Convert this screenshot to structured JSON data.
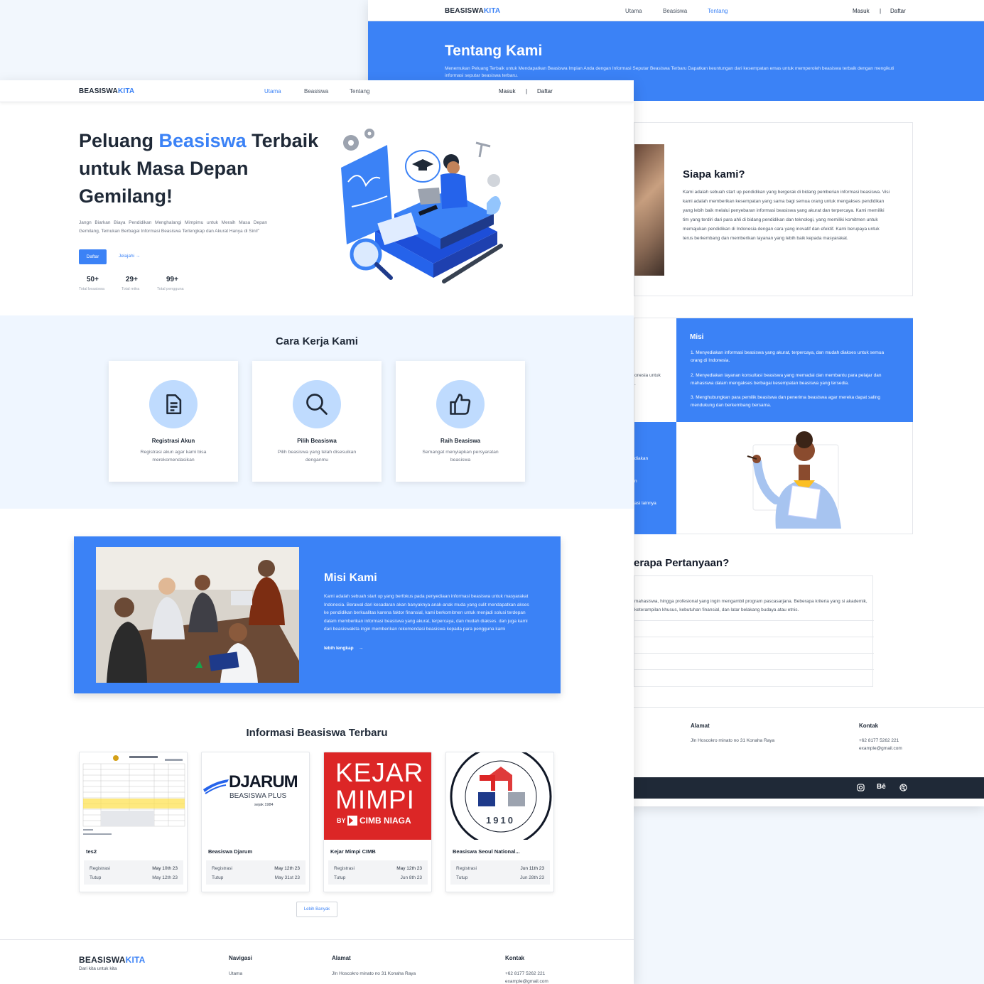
{
  "brand": {
    "name": "BEASISWA",
    "accent": "KITA",
    "tagline": "Dari kita untuk kita"
  },
  "nav": {
    "home": "Utama",
    "scholarship": "Beasiswa",
    "about": "Tentang",
    "login": "Masuk",
    "separator": "|",
    "register": "Daftar"
  },
  "about_page": {
    "hero_title": "Tentang Kami",
    "hero_desc": "Menemukan Peluang Terbaik untuk Mendapatkan Beasiswa Impian Anda dengan Informasi Seputar Beasiswa Terbaru Dapatkan keuntungan dari kesempatan emas untuk memperoleh beasiswa terbaik dengan mengikuti informasi seputar beasiswa terbaru.",
    "who_title": "Siapa kami?",
    "who_text": "Kami adalah sebuah start up pendidikan yang bergerak di bidang pemberian informasi beasiswa. Visi kami adalah memberikan kesempatan yang sama bagi semua orang untuk mengakses pendidikan yang lebih baik melalui penyebaran informasi beasiswa yang akurat dan terpercaya. Kami memiliki tim yang terdiri dari para ahli di bidang pendidikan dan teknologi, yang memiliki komitmen untuk memajukan pendidikan di Indonesia dengan cara yang inovatif dan efektif. Kami berupaya untuk terus berkembang dan memberikan layanan yang lebih baik kepada masyarakat.",
    "mission_title": "Misi",
    "missions": [
      "1. Menyediakan informasi beasiswa yang akurat, terpercaya, dan mudah diakses untuk semua orang di Indonesia.",
      "2. Menyediakan layanan konsultasi beasiswa yang memadai dan membantu para pelajar dan mahasiswa dalam mengakses berbagai kesempatan beasiswa yang tersedia.",
      "3. Menghubungkan para pemilik beasiswa dan penerima beasiswa agar mereka dapat saling mendukung dan berkembang bersama."
    ],
    "left_fragment_1": "onesia untuk",
    "left_fragment_2": ".",
    "left_fragment_3": "diakan",
    "left_fragment_4": "n",
    "left_fragment_5": "asi lainnya",
    "faq_title": "erapa Pertanyaan?",
    "faq_answer": "mahasiswa, hingga profesional yang ingin mengambil program pascasarjana. Beberapa kriteria yang si akademik, keterampilan khusus, kebutuhan finansial, dan latar belakang budaya atau etnis.",
    "footer_address_title": "Alamat",
    "footer_address": "Jln Hoscokro minato no 31 Konaha Raya",
    "footer_contact_title": "Kontak",
    "footer_phone": "+62 8177 5262 221",
    "footer_email": "example@gmail.com",
    "social": {
      "instagram": "instagram-icon",
      "behance": "Bē",
      "dribbble": "dribbble-icon"
    }
  },
  "home_page": {
    "hero_title_1": "Peluang ",
    "hero_title_accent": "Beasiswa",
    "hero_title_2": " Terbaik",
    "hero_title_3": "untuk Masa Depan",
    "hero_title_4": "Gemilang!",
    "hero_desc": "Jangn Biarkan Biaya Pendidikan Menghalangi Mimpimu untuk Meraih Masa Depan Gemilang, Temukan Berbagai Informasi Beasiswa Terlengkap dan Akurat Hanya di Sini!\"",
    "cta_register": "Daftar",
    "cta_explore": "Jelajahi",
    "stats": [
      {
        "value": "50+",
        "label": "Total beasiswa"
      },
      {
        "value": "29+",
        "label": "Total mitra"
      },
      {
        "value": "99+",
        "label": "Total pengguna"
      }
    ],
    "how_title": "Cara Kerja Kami",
    "steps": [
      {
        "title": "Registrasi Akun",
        "desc": "Registrasi akun agar kami bisa merekomendasikan",
        "icon": "document-icon"
      },
      {
        "title": "Pilih Beasiswa",
        "desc": "Pilih beasiswa yang telah disesuikan denganmu",
        "icon": "search-icon"
      },
      {
        "title": "Raih Beasiswa",
        "desc": "Semangat menyiapkan persyaratan beasiswa",
        "icon": "thumbs-up-icon"
      }
    ],
    "mission_title": "Misi Kami",
    "mission_text": "Kami adalah sebuah start up yang berfokus pada penyediaan informasi beasiswa untuk masyarakat Indonesia. Berawal dari kesadaran akan banyaknya anak-anak muda yang sulit mendapatkan akses ke pendidikan berkualitas karena faktor finansial, kami berkomitmen untuk menjadi solusi terdepan dalam memberikan informasi beasiswa yang akurat, terpercaya, dan mudah diakses. dan juga kami dari beasiswakita ingin memberikan rekomendasi beasiswa kepada para pengguna kami",
    "mission_link": "lebih lengkap",
    "latest_title": "Informasi Beasiswa Terbaru",
    "scholarships": [
      {
        "title": "tes2",
        "reg_label": "Registrasi",
        "reg": "May 10th 23",
        "close_label": "Tutup",
        "close": "May 12th 23"
      },
      {
        "title": "Beasiswa Djarum",
        "reg_label": "Registrasi",
        "reg": "May 12th 23",
        "close_label": "Tutup",
        "close": "May 31st 23"
      },
      {
        "title": "Kejar Mimpi CIMB",
        "reg_label": "Registrasi",
        "reg": "May 12th 23",
        "close_label": "Tutup",
        "close": "Jun 8th 23"
      },
      {
        "title": "Beasiswa Seoul National...",
        "reg_label": "Registrasi",
        "reg": "Jun 11th 23",
        "close_label": "Tutup",
        "close": "Jun 28th 23"
      }
    ],
    "djarum_logo": {
      "name": "DJARUM",
      "sub": "BEASISWA PLUS",
      "since": "sejak 1984"
    },
    "cimb_logo": {
      "line1": "KEJAR",
      "line2": "MIMPI",
      "by": "BY",
      "bank": "CIMB NIAGA"
    },
    "seoul_logo": {
      "year": "1910",
      "ring": "SEOUL NATIONAL UNIVERSITY OF SCIENCE & TECHNOLOGY",
      "korean": "서울과학기술대학교"
    },
    "more_button": "Lebih Banyak",
    "footer_nav_title": "Navigasi",
    "footer_nav_1": "Utama",
    "footer_address_title": "Alamat",
    "footer_address": "Jln Hoscokro minato no 31 Konaha Raya",
    "footer_contact_title": "Kontak",
    "footer_phone": "+62 8177 5262 221",
    "footer_email": "example@gmail.com"
  },
  "colors": {
    "primary": "#3b82f6",
    "light_bg": "#eff6ff",
    "dark_footer": "#1f2937"
  }
}
